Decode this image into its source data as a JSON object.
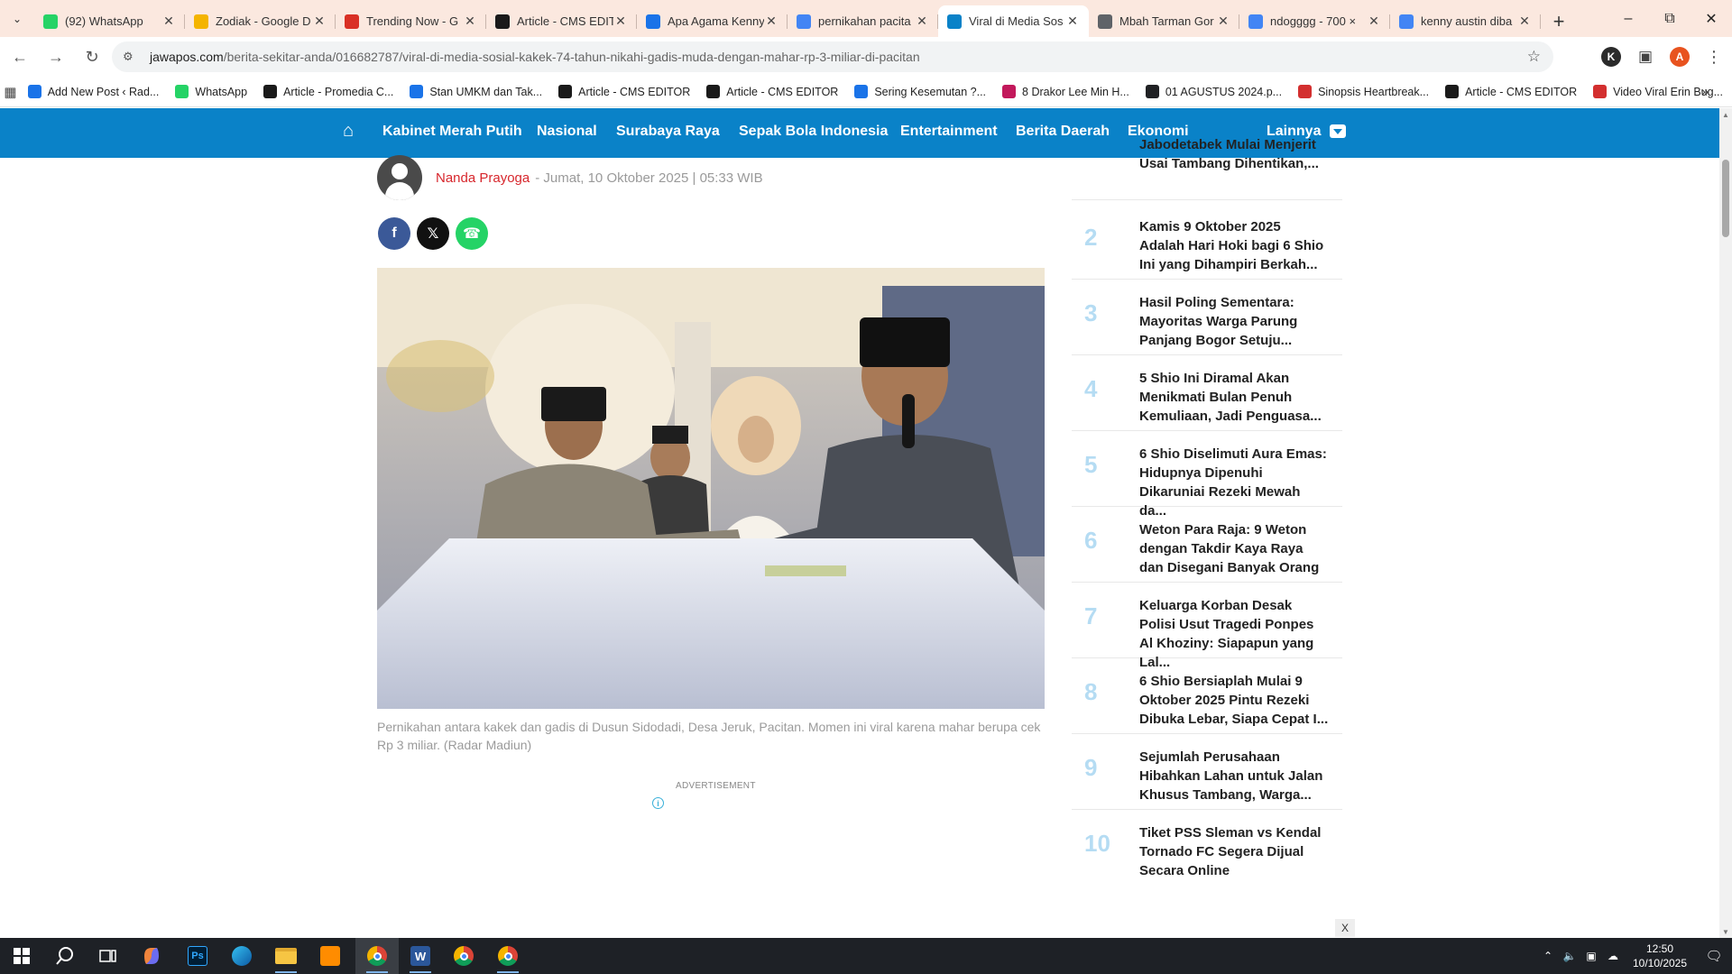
{
  "browser": {
    "tabs": [
      {
        "title": "(92) WhatsApp",
        "icon": "whatsapp-icon",
        "color": "#25d366",
        "active": false
      },
      {
        "title": "Zodiak - Google D",
        "icon": "google-drive-icon",
        "color": "#f4b400",
        "active": false
      },
      {
        "title": "Trending Now - G",
        "icon": "trending-icon",
        "color": "#d93025",
        "active": false
      },
      {
        "title": "Article - CMS EDIT",
        "icon": "cms-icon",
        "color": "#1a1a1a",
        "active": false
      },
      {
        "title": "Apa Agama Kenny",
        "icon": "page-icon",
        "color": "#1a73e8",
        "active": false
      },
      {
        "title": "pernikahan pacita",
        "icon": "google-icon",
        "color": "#4285f4",
        "active": false
      },
      {
        "title": "Viral di Media Sos",
        "icon": "jawapos-icon",
        "color": "#0a82c8",
        "active": true
      },
      {
        "title": "Mbah Tarman Gor",
        "icon": "link-icon",
        "color": "#5f6368",
        "active": false
      },
      {
        "title": "ndogggg - 700 ×",
        "icon": "google-lens-icon",
        "color": "#4285f4",
        "active": false
      },
      {
        "title": "kenny austin diba",
        "icon": "google-icon",
        "color": "#4285f4",
        "active": false
      }
    ],
    "url_host": "jawapos.com",
    "url_path": "/berita-sekitar-anda/016682787/viral-di-media-sosial-kakek-74-tahun-nikahi-gadis-muda-dengan-mahar-rp-3-miliar-di-pacitan",
    "profile_initial": "A",
    "bookmarks": [
      {
        "label": "Add New Post ‹ Rad...",
        "icon": "page-icon",
        "color": "#1a73e8"
      },
      {
        "label": "WhatsApp",
        "icon": "whatsapp-icon",
        "color": "#25d366"
      },
      {
        "label": "Article - Promedia C...",
        "icon": "cms-icon",
        "color": "#1a1a1a"
      },
      {
        "label": "Stan UMKM dan Tak...",
        "icon": "page-icon",
        "color": "#1a73e8"
      },
      {
        "label": "Article - CMS EDITOR",
        "icon": "cms-icon",
        "color": "#1a1a1a"
      },
      {
        "label": "Article - CMS EDITOR",
        "icon": "cms-icon",
        "color": "#1a1a1a"
      },
      {
        "label": "Sering Kesemutan ?...",
        "icon": "page-icon",
        "color": "#1a73e8"
      },
      {
        "label": "8 Drakor Lee Min H...",
        "icon": "drakor-icon",
        "color": "#c2185b"
      },
      {
        "label": "01 AGUSTUS 2024.p...",
        "icon": "globe-icon",
        "color": "#202124"
      },
      {
        "label": "Sinopsis Heartbreak...",
        "icon": "om-icon",
        "color": "#d32f2f"
      },
      {
        "label": "Article - CMS EDITOR",
        "icon": "cms-icon",
        "color": "#1a1a1a"
      },
      {
        "label": "Video Viral Erin Bug...",
        "icon": "d-icon",
        "color": "#d32f2f"
      }
    ]
  },
  "site": {
    "nav": [
      "Kabinet Merah Putih",
      "Nasional",
      "Surabaya Raya",
      "Sepak Bola Indonesia",
      "Entertainment",
      "Berita Daerah",
      "Ekonomi"
    ],
    "nav_more": "Lainnya",
    "accent": "#0a82c8"
  },
  "article": {
    "author": "Nanda Prayoga",
    "date": "- Jumat, 10 Oktober 2025 | 05:33 WIB",
    "caption": "Pernikahan antara kakek dan gadis di Dusun Sidodadi, Desa Jeruk, Pacitan. Momen ini viral karena mahar berupa cek Rp 3 miliar. (Radar Madiun)",
    "ad_label": "ADVERTISEMENT",
    "share": [
      {
        "name": "facebook-share-button",
        "glyph": "f",
        "color": "#3b5998"
      },
      {
        "name": "x-share-button",
        "glyph": "𝕏",
        "color": "#111111"
      },
      {
        "name": "whatsapp-share-button",
        "glyph": "☎",
        "color": "#25d366"
      }
    ]
  },
  "sidebar": {
    "items": [
      {
        "num": "",
        "title": "Jabodetabek Mulai Menjerit Usai Tambang Dihentikan,..."
      },
      {
        "num": "2",
        "title": "Kamis 9 Oktober 2025 Adalah Hari Hoki bagi 6 Shio Ini yang Dihampiri Berkah..."
      },
      {
        "num": "3",
        "title": "Hasil Poling Sementara: Mayoritas Warga Parung Panjang Bogor Setuju..."
      },
      {
        "num": "4",
        "title": "5 Shio Ini Diramal Akan Menikmati Bulan Penuh Kemuliaan, Jadi Penguasa..."
      },
      {
        "num": "5",
        "title": "6 Shio Diselimuti Aura Emas: Hidupnya Dipenuhi Dikaruniai Rezeki Mewah da..."
      },
      {
        "num": "6",
        "title": "Weton Para Raja: 9 Weton dengan Takdir Kaya Raya dan Disegani Banyak Orang"
      },
      {
        "num": "7",
        "title": "Keluarga Korban Desak Polisi Usut Tragedi Ponpes Al Khoziny: Siapapun yang Lal..."
      },
      {
        "num": "8",
        "title": "6 Shio Bersiaplah Mulai 9 Oktober 2025 Pintu Rezeki Dibuka Lebar, Siapa Cepat I..."
      },
      {
        "num": "9",
        "title": "Sejumlah Perusahaan Hibahkan Lahan untuk Jalan Khusus Tambang, Warga..."
      },
      {
        "num": "10",
        "title": "Tiket PSS Sleman vs Kendal Tornado FC Segera Dijual Secara Online"
      }
    ]
  },
  "close_ad": "X",
  "taskbar": {
    "time": "12:50",
    "date": "10/10/2025"
  }
}
